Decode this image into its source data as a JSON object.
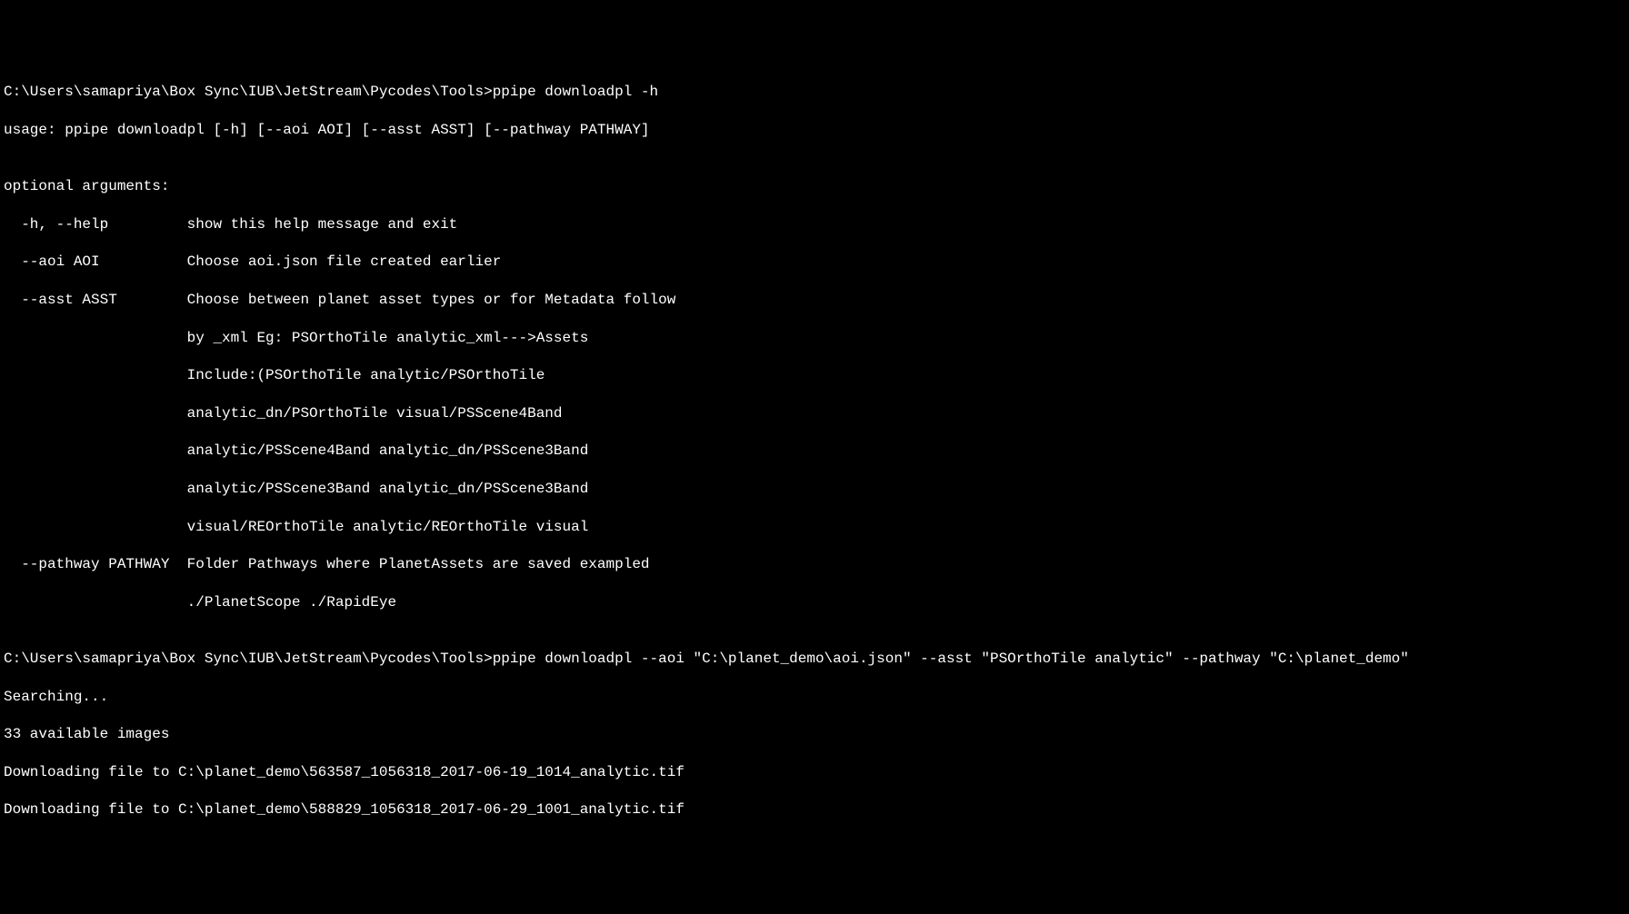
{
  "terminal": {
    "prompt1": "C:\\Users\\samapriya\\Box Sync\\IUB\\JetStream\\Pycodes\\Tools>",
    "command1": "ppipe downloadpl -h",
    "usage": "usage: ppipe downloadpl [-h] [--aoi AOI] [--asst ASST] [--pathway PATHWAY]",
    "blank": "",
    "optargs_header": "optional arguments:",
    "help_line": "  -h, --help         show this help message and exit",
    "aoi_line": "  --aoi AOI          Choose aoi.json file created earlier",
    "asst_line1": "  --asst ASST        Choose between planet asset types or for Metadata follow",
    "asst_line2": "                     by _xml Eg: PSOrthoTile analytic_xml--->Assets",
    "asst_line3": "                     Include:(PSOrthoTile analytic/PSOrthoTile",
    "asst_line4": "                     analytic_dn/PSOrthoTile visual/PSScene4Band",
    "asst_line5": "                     analytic/PSScene4Band analytic_dn/PSScene3Band",
    "asst_line6": "                     analytic/PSScene3Band analytic_dn/PSScene3Band",
    "asst_line7": "                     visual/REOrthoTile analytic/REOrthoTile visual",
    "pathway_line1": "  --pathway PATHWAY  Folder Pathways where PlanetAssets are saved exampled",
    "pathway_line2": "                     ./PlanetScope ./RapidEye",
    "prompt2": "C:\\Users\\samapriya\\Box Sync\\IUB\\JetStream\\Pycodes\\Tools>",
    "command2": "ppipe downloadpl --aoi \"C:\\planet_demo\\aoi.json\" --asst \"PSOrthoTile analytic\" --pathway \"C:\\planet_demo\"",
    "searching": "Searching...",
    "available": "33 available images",
    "download1": "Downloading file to C:\\planet_demo\\563587_1056318_2017-06-19_1014_analytic.tif",
    "download2": "Downloading file to C:\\planet_demo\\588829_1056318_2017-06-29_1001_analytic.tif"
  }
}
